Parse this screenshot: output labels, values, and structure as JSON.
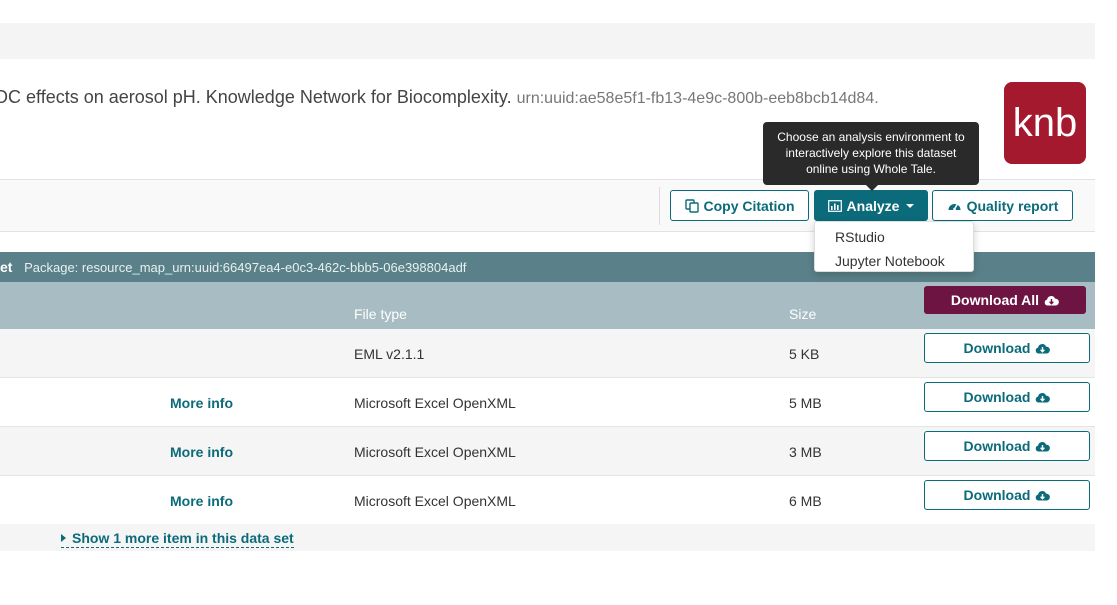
{
  "citation": {
    "text": "OC effects on aerosol pH. Knowledge Network for Biocomplexity.",
    "urn": "urn:uuid:ae58e5f1-fb13-4e9c-800b-eeb8bcb14d84."
  },
  "logo": {
    "text": "knb",
    "color": "#a5192e"
  },
  "toolbar": {
    "copy_citation": "Copy Citation",
    "analyze": "Analyze",
    "quality_report": "Quality report"
  },
  "tooltip": {
    "text": "Choose an analysis environment to interactively explore this dataset online using Whole Tale."
  },
  "analyze_menu": {
    "items": [
      "RStudio",
      "Jupyter Notebook"
    ]
  },
  "package": {
    "header_prefix": "et",
    "id": "Package: resource_map_urn:uuid:66497ea4-e0c3-462c-bbb5-06e398804adf"
  },
  "table": {
    "columns": {
      "file_type": "File type",
      "size": "Size"
    },
    "download_all": "Download All",
    "rows": [
      {
        "more_info": "",
        "file_type": "EML v2.1.1",
        "size": "5 KB",
        "download": "Download"
      },
      {
        "more_info": "More info",
        "file_type": "Microsoft Excel OpenXML",
        "size": "5 MB",
        "download": "Download"
      },
      {
        "more_info": "More info",
        "file_type": "Microsoft Excel OpenXML",
        "size": "3 MB",
        "download": "Download"
      },
      {
        "more_info": "More info",
        "file_type": "Microsoft Excel OpenXML",
        "size": "6 MB",
        "download": "Download"
      }
    ]
  },
  "show_more": "Show 1 more item in this data set",
  "colors": {
    "teal": "#0b6b7a",
    "package_bar": "#5a8189",
    "column_header": "#a7bcc3",
    "download_all": "#6e1442"
  }
}
